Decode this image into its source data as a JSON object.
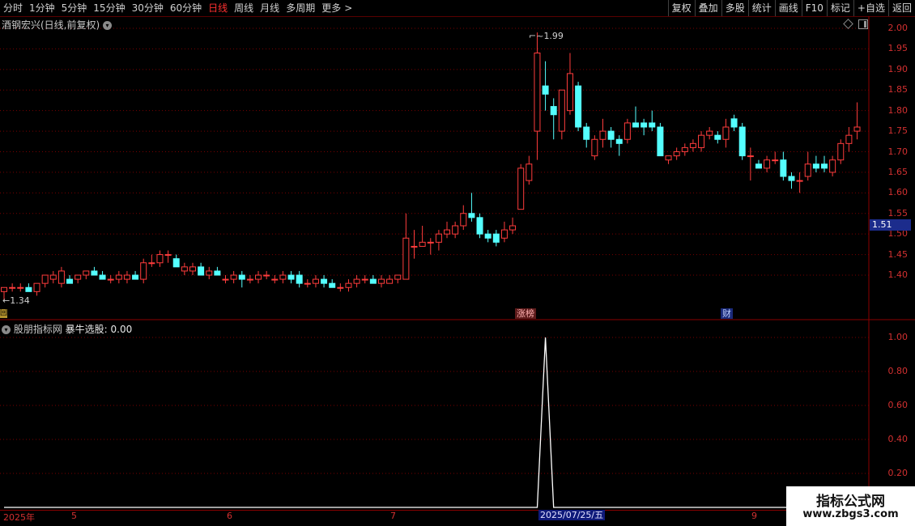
{
  "toolbar": {
    "periods": [
      "分时",
      "1分钟",
      "5分钟",
      "15分钟",
      "30分钟",
      "60分钟",
      "日线",
      "周线",
      "月线",
      "多周期",
      "更多"
    ],
    "active_period": "日线",
    "more_arrow": ">",
    "buttons": [
      "复权",
      "叠加",
      "多股",
      "统计",
      "画线",
      "F10",
      "标记",
      "+自选",
      "返回"
    ]
  },
  "main_panel": {
    "title": "酒钢宏兴(日线,前复权)",
    "price_axis": [
      "2.00",
      "1.95",
      "1.90",
      "1.85",
      "1.80",
      "1.75",
      "1.70",
      "1.65",
      "1.60",
      "1.55",
      "1.50",
      "1.45",
      "1.40"
    ],
    "last_price": "1.51",
    "high_annotation": "1.99",
    "low_annotation": "1.34",
    "events": [
      "涨榜",
      "财"
    ],
    "left_marker": "回"
  },
  "indicator_panel": {
    "title_prefix": "股朋指标网",
    "title_name": "暴牛选股:",
    "title_value": "0.00",
    "axis": [
      "1.00",
      "0.80",
      "0.60",
      "0.40",
      "0.20"
    ]
  },
  "date_axis": {
    "labels": [
      "2025年",
      "5",
      "6",
      "7",
      "9"
    ],
    "selected": "2025/07/25/五"
  },
  "watermark": {
    "title": "指标公式网",
    "url": "www.zbgs3.com"
  },
  "colors": {
    "up": "#ff3c3c",
    "down": "#54ffff",
    "grid": "#7a0000",
    "axis": "#d23030",
    "background": "#000000"
  },
  "chart_data": [
    {
      "type": "candlestick",
      "title": "酒钢宏兴(日线,前复权)",
      "ylim": [
        1.33,
        2.02
      ],
      "candles": [
        {
          "o": 1.36,
          "h": 1.37,
          "l": 1.34,
          "c": 1.37
        },
        {
          "o": 1.37,
          "h": 1.38,
          "l": 1.36,
          "c": 1.37
        },
        {
          "o": 1.37,
          "h": 1.38,
          "l": 1.36,
          "c": 1.37
        },
        {
          "o": 1.37,
          "h": 1.38,
          "l": 1.36,
          "c": 1.36
        },
        {
          "o": 1.36,
          "h": 1.38,
          "l": 1.35,
          "c": 1.38
        },
        {
          "o": 1.38,
          "h": 1.4,
          "l": 1.37,
          "c": 1.4
        },
        {
          "o": 1.39,
          "h": 1.41,
          "l": 1.38,
          "c": 1.4
        },
        {
          "o": 1.38,
          "h": 1.42,
          "l": 1.37,
          "c": 1.41
        },
        {
          "o": 1.39,
          "h": 1.4,
          "l": 1.38,
          "c": 1.38
        },
        {
          "o": 1.39,
          "h": 1.4,
          "l": 1.38,
          "c": 1.4
        },
        {
          "o": 1.4,
          "h": 1.41,
          "l": 1.39,
          "c": 1.41
        },
        {
          "o": 1.41,
          "h": 1.42,
          "l": 1.4,
          "c": 1.4
        },
        {
          "o": 1.4,
          "h": 1.41,
          "l": 1.39,
          "c": 1.39
        },
        {
          "o": 1.39,
          "h": 1.4,
          "l": 1.38,
          "c": 1.39
        },
        {
          "o": 1.39,
          "h": 1.41,
          "l": 1.38,
          "c": 1.4
        },
        {
          "o": 1.39,
          "h": 1.41,
          "l": 1.38,
          "c": 1.4
        },
        {
          "o": 1.4,
          "h": 1.41,
          "l": 1.39,
          "c": 1.39
        },
        {
          "o": 1.39,
          "h": 1.44,
          "l": 1.38,
          "c": 1.43
        },
        {
          "o": 1.43,
          "h": 1.45,
          "l": 1.42,
          "c": 1.43
        },
        {
          "o": 1.43,
          "h": 1.46,
          "l": 1.42,
          "c": 1.45
        },
        {
          "o": 1.45,
          "h": 1.46,
          "l": 1.43,
          "c": 1.45
        },
        {
          "o": 1.44,
          "h": 1.45,
          "l": 1.42,
          "c": 1.42
        },
        {
          "o": 1.41,
          "h": 1.43,
          "l": 1.4,
          "c": 1.42
        },
        {
          "o": 1.41,
          "h": 1.43,
          "l": 1.4,
          "c": 1.42
        },
        {
          "o": 1.42,
          "h": 1.43,
          "l": 1.4,
          "c": 1.4
        },
        {
          "o": 1.4,
          "h": 1.42,
          "l": 1.39,
          "c": 1.41
        },
        {
          "o": 1.41,
          "h": 1.42,
          "l": 1.4,
          "c": 1.4
        },
        {
          "o": 1.39,
          "h": 1.4,
          "l": 1.38,
          "c": 1.39
        },
        {
          "o": 1.39,
          "h": 1.41,
          "l": 1.38,
          "c": 1.4
        },
        {
          "o": 1.4,
          "h": 1.41,
          "l": 1.37,
          "c": 1.39
        },
        {
          "o": 1.39,
          "h": 1.4,
          "l": 1.38,
          "c": 1.39
        },
        {
          "o": 1.39,
          "h": 1.41,
          "l": 1.38,
          "c": 1.4
        },
        {
          "o": 1.4,
          "h": 1.41,
          "l": 1.39,
          "c": 1.4
        },
        {
          "o": 1.39,
          "h": 1.4,
          "l": 1.38,
          "c": 1.39
        },
        {
          "o": 1.39,
          "h": 1.41,
          "l": 1.38,
          "c": 1.4
        },
        {
          "o": 1.4,
          "h": 1.41,
          "l": 1.38,
          "c": 1.39
        },
        {
          "o": 1.4,
          "h": 1.41,
          "l": 1.37,
          "c": 1.38
        },
        {
          "o": 1.38,
          "h": 1.39,
          "l": 1.37,
          "c": 1.38
        },
        {
          "o": 1.38,
          "h": 1.4,
          "l": 1.37,
          "c": 1.39
        },
        {
          "o": 1.39,
          "h": 1.4,
          "l": 1.37,
          "c": 1.38
        },
        {
          "o": 1.38,
          "h": 1.39,
          "l": 1.37,
          "c": 1.37
        },
        {
          "o": 1.37,
          "h": 1.38,
          "l": 1.36,
          "c": 1.37
        },
        {
          "o": 1.37,
          "h": 1.39,
          "l": 1.36,
          "c": 1.38
        },
        {
          "o": 1.38,
          "h": 1.4,
          "l": 1.37,
          "c": 1.39
        },
        {
          "o": 1.39,
          "h": 1.4,
          "l": 1.38,
          "c": 1.39
        },
        {
          "o": 1.39,
          "h": 1.4,
          "l": 1.38,
          "c": 1.38
        },
        {
          "o": 1.38,
          "h": 1.4,
          "l": 1.37,
          "c": 1.39
        },
        {
          "o": 1.38,
          "h": 1.4,
          "l": 1.38,
          "c": 1.39
        },
        {
          "o": 1.39,
          "h": 1.4,
          "l": 1.38,
          "c": 1.4
        },
        {
          "o": 1.39,
          "h": 1.55,
          "l": 1.39,
          "c": 1.49
        },
        {
          "o": 1.47,
          "h": 1.51,
          "l": 1.44,
          "c": 1.47
        },
        {
          "o": 1.47,
          "h": 1.52,
          "l": 1.47,
          "c": 1.48
        },
        {
          "o": 1.48,
          "h": 1.49,
          "l": 1.45,
          "c": 1.48
        },
        {
          "o": 1.48,
          "h": 1.51,
          "l": 1.46,
          "c": 1.5
        },
        {
          "o": 1.5,
          "h": 1.53,
          "l": 1.49,
          "c": 1.51
        },
        {
          "o": 1.5,
          "h": 1.53,
          "l": 1.49,
          "c": 1.52
        },
        {
          "o": 1.52,
          "h": 1.57,
          "l": 1.51,
          "c": 1.55
        },
        {
          "o": 1.55,
          "h": 1.6,
          "l": 1.53,
          "c": 1.54
        },
        {
          "o": 1.54,
          "h": 1.55,
          "l": 1.49,
          "c": 1.5
        },
        {
          "o": 1.5,
          "h": 1.51,
          "l": 1.48,
          "c": 1.49
        },
        {
          "o": 1.5,
          "h": 1.51,
          "l": 1.47,
          "c": 1.48
        },
        {
          "o": 1.49,
          "h": 1.53,
          "l": 1.48,
          "c": 1.51
        },
        {
          "o": 1.51,
          "h": 1.54,
          "l": 1.5,
          "c": 1.52
        },
        {
          "o": 1.56,
          "h": 1.67,
          "l": 1.56,
          "c": 1.66
        },
        {
          "o": 1.63,
          "h": 1.69,
          "l": 1.62,
          "c": 1.67
        },
        {
          "o": 1.75,
          "h": 1.99,
          "l": 1.68,
          "c": 1.94
        },
        {
          "o": 1.86,
          "h": 1.92,
          "l": 1.8,
          "c": 1.84
        },
        {
          "o": 1.81,
          "h": 1.83,
          "l": 1.73,
          "c": 1.79
        },
        {
          "o": 1.75,
          "h": 1.85,
          "l": 1.73,
          "c": 1.85
        },
        {
          "o": 1.8,
          "h": 1.94,
          "l": 1.79,
          "c": 1.89
        },
        {
          "o": 1.86,
          "h": 1.87,
          "l": 1.75,
          "c": 1.76
        },
        {
          "o": 1.76,
          "h": 1.77,
          "l": 1.71,
          "c": 1.73
        },
        {
          "o": 1.69,
          "h": 1.74,
          "l": 1.68,
          "c": 1.73
        },
        {
          "o": 1.73,
          "h": 1.78,
          "l": 1.71,
          "c": 1.75
        },
        {
          "o": 1.75,
          "h": 1.76,
          "l": 1.71,
          "c": 1.73
        },
        {
          "o": 1.73,
          "h": 1.74,
          "l": 1.69,
          "c": 1.72
        },
        {
          "o": 1.73,
          "h": 1.78,
          "l": 1.72,
          "c": 1.77
        },
        {
          "o": 1.77,
          "h": 1.81,
          "l": 1.76,
          "c": 1.76
        },
        {
          "o": 1.77,
          "h": 1.78,
          "l": 1.74,
          "c": 1.76
        },
        {
          "o": 1.77,
          "h": 1.8,
          "l": 1.75,
          "c": 1.76
        },
        {
          "o": 1.76,
          "h": 1.77,
          "l": 1.69,
          "c": 1.69
        },
        {
          "o": 1.68,
          "h": 1.69,
          "l": 1.67,
          "c": 1.69
        },
        {
          "o": 1.69,
          "h": 1.71,
          "l": 1.68,
          "c": 1.7
        },
        {
          "o": 1.7,
          "h": 1.72,
          "l": 1.69,
          "c": 1.71
        },
        {
          "o": 1.71,
          "h": 1.73,
          "l": 1.7,
          "c": 1.72
        },
        {
          "o": 1.71,
          "h": 1.75,
          "l": 1.7,
          "c": 1.74
        },
        {
          "o": 1.74,
          "h": 1.76,
          "l": 1.73,
          "c": 1.75
        },
        {
          "o": 1.74,
          "h": 1.75,
          "l": 1.72,
          "c": 1.73
        },
        {
          "o": 1.73,
          "h": 1.78,
          "l": 1.71,
          "c": 1.76
        },
        {
          "o": 1.78,
          "h": 1.79,
          "l": 1.75,
          "c": 1.76
        },
        {
          "o": 1.76,
          "h": 1.77,
          "l": 1.68,
          "c": 1.69
        },
        {
          "o": 1.69,
          "h": 1.71,
          "l": 1.63,
          "c": 1.69
        },
        {
          "o": 1.67,
          "h": 1.68,
          "l": 1.66,
          "c": 1.66
        },
        {
          "o": 1.66,
          "h": 1.69,
          "l": 1.65,
          "c": 1.68
        },
        {
          "o": 1.68,
          "h": 1.7,
          "l": 1.67,
          "c": 1.68
        },
        {
          "o": 1.68,
          "h": 1.7,
          "l": 1.63,
          "c": 1.64
        },
        {
          "o": 1.64,
          "h": 1.65,
          "l": 1.61,
          "c": 1.63
        },
        {
          "o": 1.63,
          "h": 1.65,
          "l": 1.6,
          "c": 1.63
        },
        {
          "o": 1.64,
          "h": 1.7,
          "l": 1.63,
          "c": 1.67
        },
        {
          "o": 1.67,
          "h": 1.69,
          "l": 1.65,
          "c": 1.66
        },
        {
          "o": 1.67,
          "h": 1.69,
          "l": 1.65,
          "c": 1.66
        },
        {
          "o": 1.65,
          "h": 1.69,
          "l": 1.64,
          "c": 1.68
        },
        {
          "o": 1.68,
          "h": 1.73,
          "l": 1.67,
          "c": 1.72
        },
        {
          "o": 1.72,
          "h": 1.76,
          "l": 1.7,
          "c": 1.74
        },
        {
          "o": 1.75,
          "h": 1.82,
          "l": 1.73,
          "c": 1.76
        }
      ]
    },
    {
      "type": "line",
      "name": "暴牛选股",
      "ylim": [
        0,
        1.05
      ],
      "values_note_index_of_spike": 66,
      "values": [
        0,
        0,
        0,
        0,
        0,
        0,
        0,
        0,
        0,
        0,
        0,
        0,
        0,
        0,
        0,
        0,
        0,
        0,
        0,
        0,
        0,
        0,
        0,
        0,
        0,
        0,
        0,
        0,
        0,
        0,
        0,
        0,
        0,
        0,
        0,
        0,
        0,
        0,
        0,
        0,
        0,
        0,
        0,
        0,
        0,
        0,
        0,
        0,
        0,
        0,
        0,
        0,
        0,
        0,
        0,
        0,
        0,
        0,
        0,
        0,
        0,
        0,
        0,
        0,
        0,
        0,
        1,
        0,
        0,
        0,
        0,
        0,
        0,
        0,
        0,
        0,
        0,
        0,
        0,
        0,
        0,
        0,
        0,
        0,
        0,
        0,
        0,
        0,
        0,
        0,
        0,
        0,
        0,
        0,
        0,
        0,
        0,
        0,
        0,
        0,
        0,
        0,
        0,
        0,
        0,
        0
      ]
    }
  ]
}
